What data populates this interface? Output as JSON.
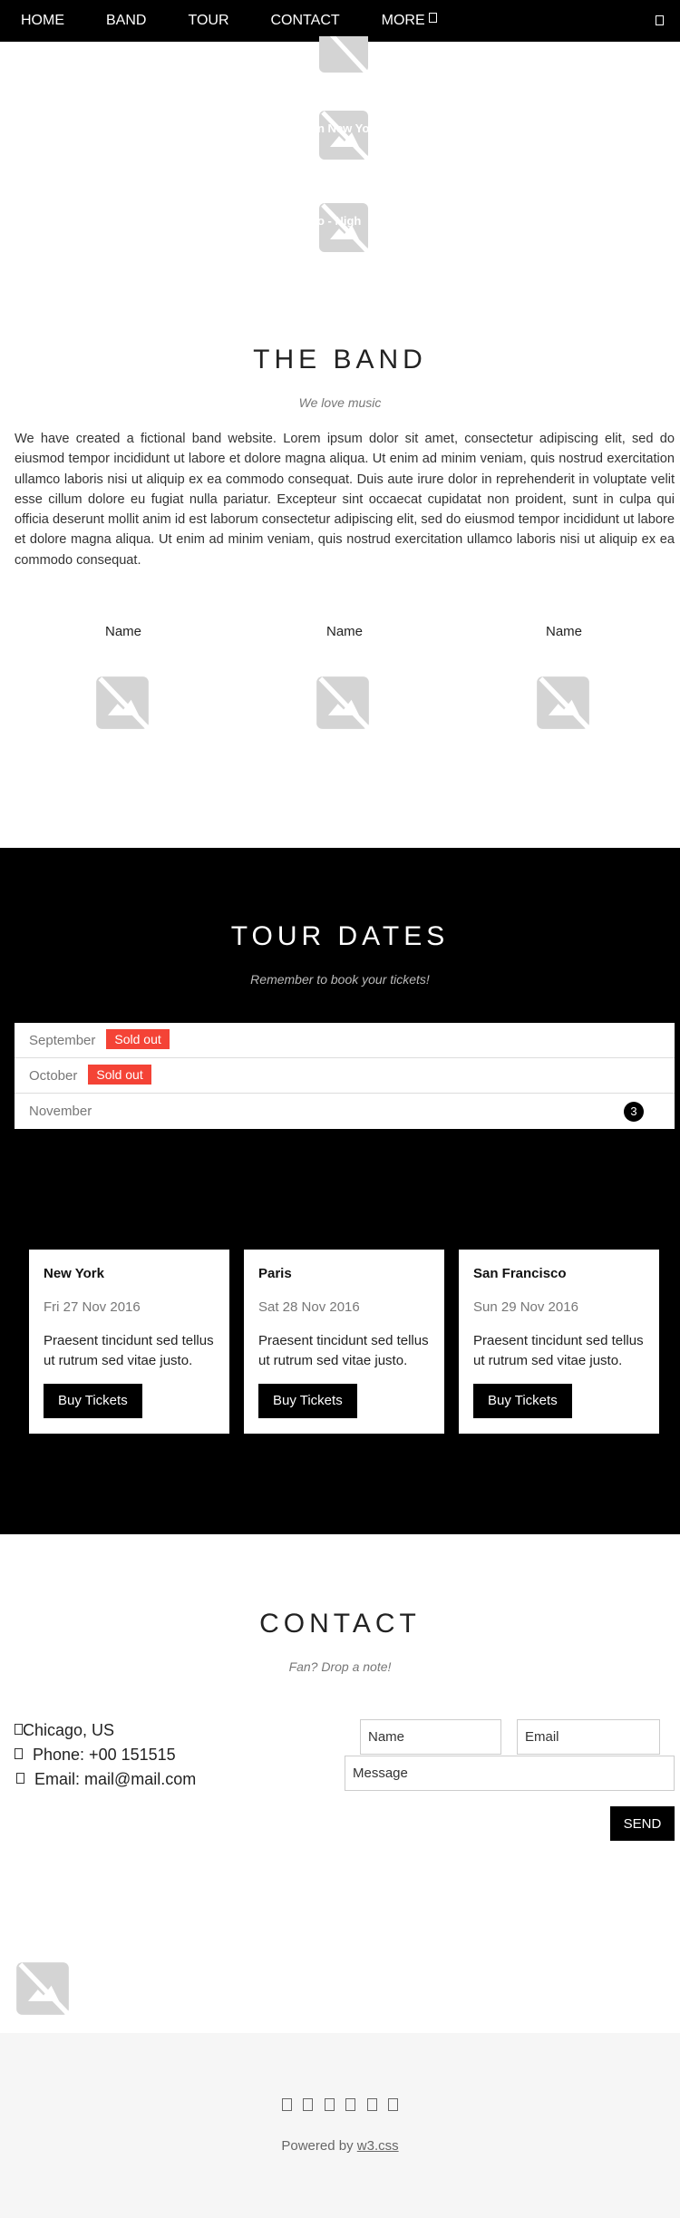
{
  "nav": {
    "items": [
      "HOME",
      "BAND",
      "TOUR",
      "CONTACT",
      "MORE"
    ]
  },
  "slides": {
    "captions": [
      "n New Yo",
      "o - Nigh"
    ]
  },
  "band": {
    "title": "THE BAND",
    "subtitle": "We love music",
    "text": "We have created a fictional band website. Lorem ipsum dolor sit amet, consectetur adipiscing elit, sed do eiusmod tempor incididunt ut labore et dolore magna aliqua. Ut enim ad minim veniam, quis nostrud exercitation ullamco laboris nisi ut aliquip ex ea commodo consequat. Duis aute irure dolor in reprehenderit in voluptate velit esse cillum dolore eu fugiat nulla pariatur. Excepteur sint occaecat cupidatat non proident, sunt in culpa qui officia deserunt mollit anim id est laborum consectetur adipiscing elit, sed do eiusmod tempor incididunt ut labore et dolore magna aliqua. Ut enim ad minim veniam, quis nostrud exercitation ullamco laboris nisi ut aliquip ex ea commodo consequat.",
    "members": [
      "Name",
      "Name",
      "Name"
    ]
  },
  "tour": {
    "title": "TOUR DATES",
    "subtitle": "Remember  to book your tickets!",
    "months": [
      {
        "label": "September",
        "badge": "Sold out"
      },
      {
        "label": "October",
        "badge": "Sold out"
      },
      {
        "label": "November",
        "count": "3"
      }
    ],
    "cards": [
      {
        "city": "New York",
        "date": "Fri 27 Nov 2016",
        "desc": "Praesent tincidunt sed tellus ut rutrum sed vitae justo.",
        "button": "Buy Tickets"
      },
      {
        "city": "Paris",
        "date": "Sat 28 Nov 2016",
        "desc": "Praesent tincidunt sed tellus ut rutrum sed vitae justo.",
        "button": "Buy Tickets"
      },
      {
        "city": "San Francisco",
        "date": "Sun 29 Nov 2016",
        "desc": "Praesent tincidunt sed tellus ut rutrum sed vitae justo.",
        "button": "Buy Tickets"
      }
    ]
  },
  "contact": {
    "title": "CONTACT",
    "subtitle": "Fan? Drop  a note!",
    "location": "Chicago, US",
    "phone": " Phone: +00 151515",
    "email": " Email: mail@mail.com",
    "name_placeholder": "Name",
    "email_placeholder": "Email",
    "message_placeholder": "Message",
    "send_label": "SEND"
  },
  "footer": {
    "powered_prefix": "Powered by ",
    "powered_link": "w3.css"
  },
  "colors": {
    "nav_bg": "#000000",
    "badge_red": "#f44336",
    "footer_bg": "#f6f6f6"
  }
}
